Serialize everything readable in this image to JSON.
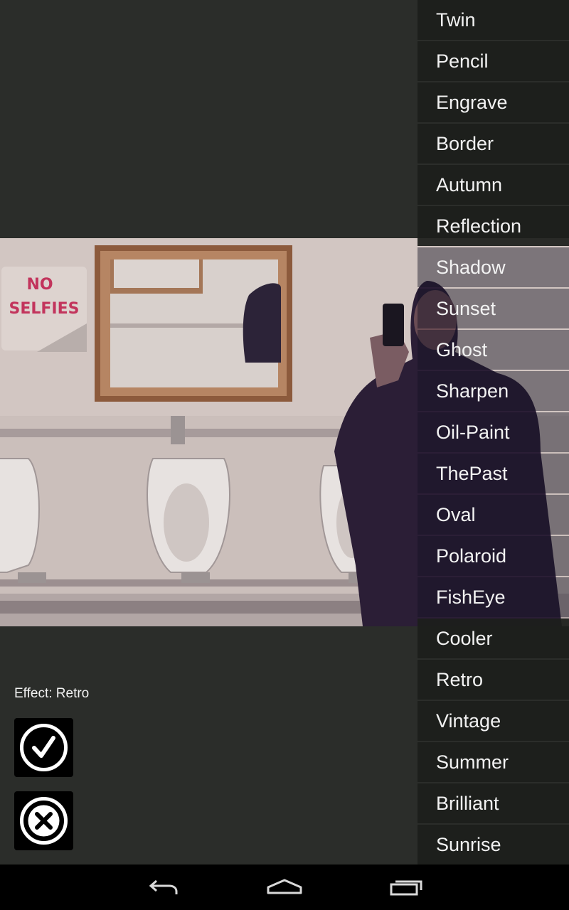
{
  "effects": [
    "Twin",
    "Pencil",
    "Engrave",
    "Border",
    "Autumn",
    "Reflection",
    "Shadow",
    "Sunset",
    "Ghost",
    "Sharpen",
    "Oil-Paint",
    "ThePast",
    "Oval",
    "Polaroid",
    "FishEye",
    "Cooler",
    "Retro",
    "Vintage",
    "Summer",
    "Brilliant",
    "Sunrise"
  ],
  "status": {
    "effect_label": "Effect: Retro"
  },
  "photo": {
    "sign_line1": "NO",
    "sign_line2": "SELFIES"
  },
  "icons": {
    "apply": "check-circle-icon",
    "cancel": "x-circle-icon",
    "back": "back-arrow-icon",
    "home": "home-icon",
    "recents": "recents-icon"
  },
  "colors": {
    "background": "#2b2d2a",
    "list_item": "#1c1e1b",
    "text": "#f2f2f2",
    "sign_text": "#c2345c"
  }
}
